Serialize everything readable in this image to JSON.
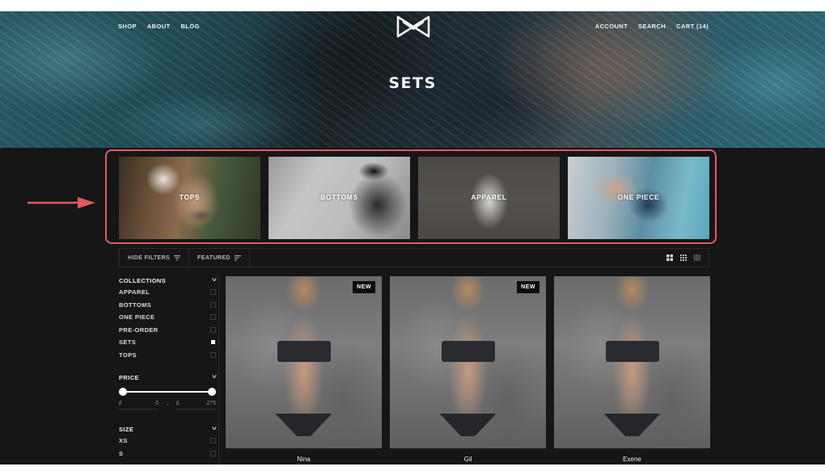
{
  "nav": {
    "left": [
      "SHOP",
      "ABOUT",
      "BLOG"
    ],
    "right": [
      "ACCOUNT",
      "SEARCH",
      "CART (14)"
    ],
    "logo_icon": "bowtie-logo-icon"
  },
  "hero": {
    "title": "SETS"
  },
  "categories": [
    {
      "label": "TOPS"
    },
    {
      "label": "BOTTOMS"
    },
    {
      "label": "APPAREL"
    },
    {
      "label": "ONE PIECE"
    }
  ],
  "annotation": {
    "color": "#e05a62",
    "arrow_icon": "right-arrow-icon"
  },
  "toolbar": {
    "hide_filters": "HIDE FILTERS",
    "hide_filters_icon": "filter-funnel-icon",
    "sort": "FEATURED",
    "sort_icon": "sort-lines-icon",
    "views": [
      "grid-2-icon",
      "grid-3-icon",
      "grid-4-icon"
    ]
  },
  "filters": {
    "collections": {
      "title": "COLLECTIONS",
      "items": [
        {
          "label": "APPAREL",
          "checked": false
        },
        {
          "label": "BOTTOMS",
          "checked": false
        },
        {
          "label": "ONE PIECE",
          "checked": false
        },
        {
          "label": "PRE-ORDER",
          "checked": false
        },
        {
          "label": "SETS",
          "checked": true
        },
        {
          "label": "TOPS",
          "checked": false
        }
      ]
    },
    "price": {
      "title": "PRICE",
      "currency": "£",
      "min": "0",
      "max": "275",
      "separator": "-",
      "range_fraction": [
        0,
        1
      ]
    },
    "size": {
      "title": "SIZE",
      "items": [
        {
          "label": "XS",
          "checked": false
        },
        {
          "label": "S",
          "checked": false
        }
      ]
    }
  },
  "products": [
    {
      "name": "Nina",
      "badge": "NEW"
    },
    {
      "name": "Gil",
      "badge": "NEW"
    },
    {
      "name": "Exene",
      "badge": ""
    }
  ]
}
